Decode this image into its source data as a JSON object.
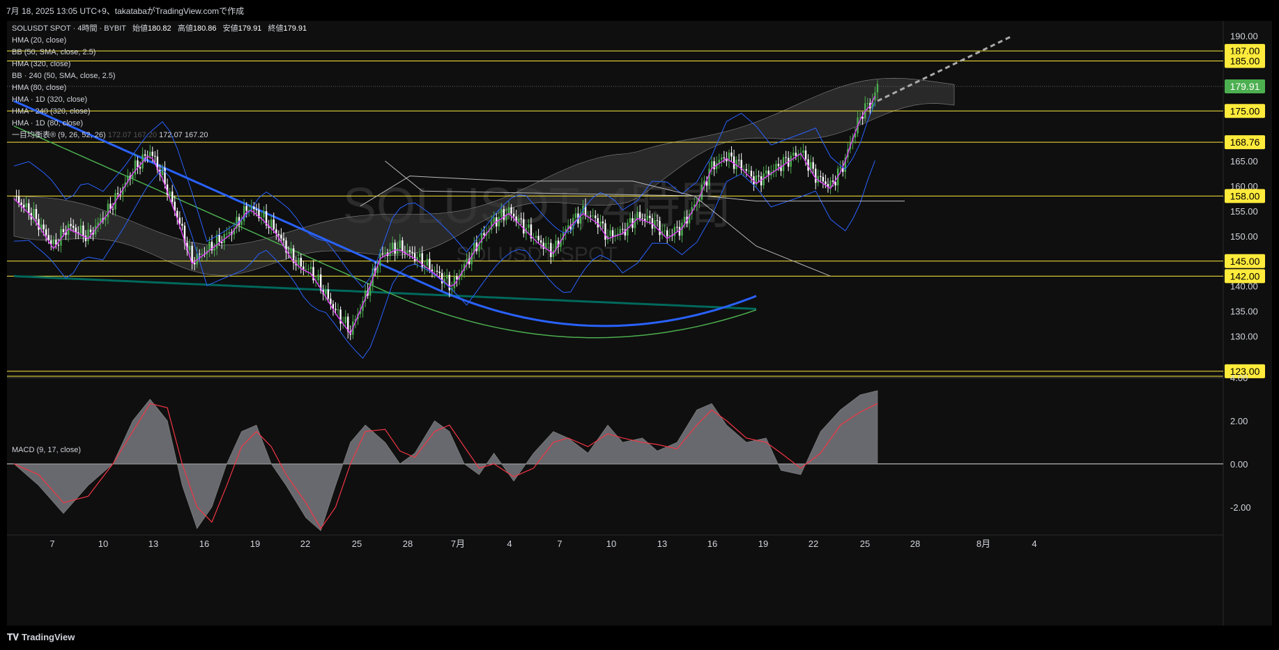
{
  "header": {
    "caption": "7月 18, 2025 13:05 UTC+9、takatabaがTradingView.comで作成"
  },
  "legend": {
    "symbol": "SOLUSDT SPOT · 4時間 · BYBIT",
    "ohlc_label_open": "始値",
    "ohlc_open": "180.82",
    "ohlc_label_high": "高値",
    "ohlc_high": "180.86",
    "ohlc_label_low": "安値",
    "ohlc_low": "179.91",
    "ohlc_label_close": "終値",
    "ohlc_close": "179.91",
    "indicators": [
      "HMA (20, close)",
      "BB (50, SMA, close, 2.5)",
      "HMA (320, close)",
      "BB · 240 (50, SMA, close, 2.5)",
      "HMA (80, close)",
      "HMA · 1D (320, close)",
      "HMA · 240 (320, close)",
      "HMA · 1D (80, close)"
    ],
    "ichimoku": "一目均衡表® (9, 26, 52, 26)",
    "ichimoku_vals": [
      "172.07",
      "167.20",
      "172.07",
      "167.20"
    ]
  },
  "watermark": {
    "line1": "SOLUSDT, 4時間",
    "line2": "SOLUSDT SPOT"
  },
  "macd": {
    "label": "MACD (9, 17, close)"
  },
  "footer": {
    "brand": "TradingView"
  },
  "colors": {
    "background": "#0f0f0f",
    "bull": "#4caf50",
    "bear": "#ffffff",
    "hma20": "#e040fb",
    "hma80": "#4caf50",
    "hma320": "#2962ff",
    "bb": "#2962ff",
    "level": "#ffeb3b",
    "macd_signal": "#f23645",
    "macd_hist": "#b2b5be",
    "long_hma": "#00695c"
  },
  "chart_data": [
    {
      "type": "candlestick",
      "symbol": "SOLUSDT SPOT",
      "interval": "4時間",
      "exchange": "BYBIT",
      "last_price": 179.91,
      "y_ticks": [
        "190.00",
        "165.00",
        "160.00",
        "155.00",
        "150.00",
        "140.00",
        "135.00",
        "130.00"
      ],
      "y_range": [
        122,
        193
      ],
      "x_ticks": [
        "7",
        "10",
        "13",
        "16",
        "19",
        "22",
        "25",
        "28",
        "7月",
        "4",
        "7",
        "10",
        "13",
        "16",
        "19",
        "22",
        "25",
        "28",
        "8月",
        "4"
      ],
      "horizontal_levels": [
        "187.00",
        "185.00",
        "175.00",
        "168.76",
        "158.00",
        "145.00",
        "142.00",
        "123.00"
      ],
      "last_price_label": "179.91",
      "close_path": [
        [
          0,
          158
        ],
        [
          8,
          154
        ],
        [
          16,
          148
        ],
        [
          22,
          152
        ],
        [
          30,
          150
        ],
        [
          38,
          155
        ],
        [
          48,
          163
        ],
        [
          55,
          167
        ],
        [
          60,
          162
        ],
        [
          66,
          154
        ],
        [
          72,
          145
        ],
        [
          80,
          148
        ],
        [
          88,
          151
        ],
        [
          95,
          156
        ],
        [
          100,
          154
        ],
        [
          106,
          151
        ],
        [
          112,
          146
        ],
        [
          116,
          144
        ],
        [
          120,
          143
        ],
        [
          124,
          140
        ],
        [
          130,
          135
        ],
        [
          136,
          131
        ],
        [
          142,
          138
        ],
        [
          148,
          146
        ],
        [
          155,
          148
        ],
        [
          162,
          146
        ],
        [
          170,
          143
        ],
        [
          177,
          140
        ],
        [
          182,
          144
        ],
        [
          188,
          149
        ],
        [
          194,
          153
        ],
        [
          200,
          155
        ],
        [
          206,
          152
        ],
        [
          212,
          149
        ],
        [
          218,
          147
        ],
        [
          224,
          152
        ],
        [
          230,
          155
        ],
        [
          236,
          153
        ],
        [
          240,
          150
        ],
        [
          246,
          151
        ],
        [
          252,
          154
        ],
        [
          258,
          153
        ],
        [
          264,
          150
        ],
        [
          270,
          152
        ],
        [
          276,
          157
        ],
        [
          282,
          164
        ],
        [
          288,
          166
        ],
        [
          294,
          164
        ],
        [
          300,
          161
        ],
        [
          306,
          163
        ],
        [
          312,
          165
        ],
        [
          318,
          167
        ],
        [
          324,
          162
        ],
        [
          330,
          160
        ],
        [
          335,
          164
        ],
        [
          339,
          170
        ],
        [
          343,
          175
        ],
        [
          347,
          177
        ],
        [
          349,
          180
        ]
      ]
    },
    {
      "type": "macd",
      "label": "MACD (9, 17, close)",
      "y_ticks": [
        "4.00",
        "2.00",
        "0.00",
        "-2.00"
      ],
      "y_range": [
        -3.3,
        4
      ],
      "histogram": [
        [
          0,
          0
        ],
        [
          10,
          -1
        ],
        [
          20,
          -2.3
        ],
        [
          30,
          -1
        ],
        [
          40,
          0
        ],
        [
          48,
          2
        ],
        [
          55,
          3
        ],
        [
          62,
          2
        ],
        [
          68,
          -1
        ],
        [
          74,
          -3
        ],
        [
          80,
          -2
        ],
        [
          86,
          0
        ],
        [
          92,
          1.5
        ],
        [
          98,
          1.8
        ],
        [
          104,
          0
        ],
        [
          110,
          -1
        ],
        [
          118,
          -2.5
        ],
        [
          124,
          -3.1
        ],
        [
          130,
          -1
        ],
        [
          136,
          1
        ],
        [
          142,
          1.8
        ],
        [
          150,
          1
        ],
        [
          156,
          0
        ],
        [
          162,
          0.5
        ],
        [
          170,
          2
        ],
        [
          176,
          1.5
        ],
        [
          182,
          0
        ],
        [
          188,
          -0.5
        ],
        [
          194,
          0.5
        ],
        [
          202,
          -0.8
        ],
        [
          210,
          0.5
        ],
        [
          218,
          1.5
        ],
        [
          224,
          1.2
        ],
        [
          232,
          0.5
        ],
        [
          240,
          1.8
        ],
        [
          246,
          1.0
        ],
        [
          254,
          1.2
        ],
        [
          260,
          0.6
        ],
        [
          268,
          1.0
        ],
        [
          276,
          2.5
        ],
        [
          282,
          2.8
        ],
        [
          288,
          1.8
        ],
        [
          296,
          1.0
        ],
        [
          304,
          1.2
        ],
        [
          310,
          -0.3
        ],
        [
          318,
          -0.5
        ],
        [
          326,
          1.5
        ],
        [
          334,
          2.5
        ],
        [
          342,
          3.2
        ],
        [
          349,
          3.4
        ]
      ],
      "signal": [
        [
          0,
          0
        ],
        [
          10,
          -0.5
        ],
        [
          20,
          -1.8
        ],
        [
          30,
          -1.5
        ],
        [
          40,
          0
        ],
        [
          48,
          1.5
        ],
        [
          55,
          2.8
        ],
        [
          62,
          2.6
        ],
        [
          68,
          0
        ],
        [
          74,
          -2
        ],
        [
          80,
          -2.7
        ],
        [
          86,
          -1
        ],
        [
          92,
          0.8
        ],
        [
          98,
          1.5
        ],
        [
          104,
          0.8
        ],
        [
          110,
          -0.5
        ],
        [
          118,
          -1.8
        ],
        [
          124,
          -3
        ],
        [
          130,
          -2
        ],
        [
          136,
          0
        ],
        [
          142,
          1.5
        ],
        [
          150,
          1.6
        ],
        [
          156,
          0.6
        ],
        [
          162,
          0.3
        ],
        [
          170,
          1.5
        ],
        [
          176,
          1.8
        ],
        [
          182,
          0.8
        ],
        [
          188,
          -0.2
        ],
        [
          194,
          0
        ],
        [
          202,
          -0.6
        ],
        [
          210,
          -0.2
        ],
        [
          218,
          1
        ],
        [
          224,
          1.2
        ],
        [
          232,
          0.8
        ],
        [
          240,
          1.4
        ],
        [
          246,
          1.2
        ],
        [
          254,
          1
        ],
        [
          260,
          0.9
        ],
        [
          268,
          0.7
        ],
        [
          276,
          1.8
        ],
        [
          282,
          2.5
        ],
        [
          288,
          2
        ],
        [
          296,
          1.2
        ],
        [
          304,
          1
        ],
        [
          310,
          0.5
        ],
        [
          318,
          -0.2
        ],
        [
          326,
          0.5
        ],
        [
          334,
          1.8
        ],
        [
          342,
          2.4
        ],
        [
          349,
          2.8
        ]
      ]
    }
  ]
}
